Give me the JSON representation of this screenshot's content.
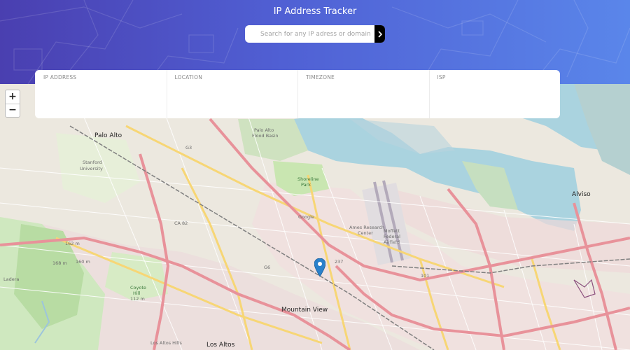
{
  "header": {
    "title": "IP Address Tracker",
    "search": {
      "placeholder": "Search for any IP adress or domain",
      "value": ""
    },
    "submit_icon": "chevron-right-icon"
  },
  "info_panel": {
    "ip_address": {
      "label": "IP ADDRESS",
      "value": ""
    },
    "location": {
      "label": "LOCATION",
      "value": ""
    },
    "timezone": {
      "label": "TIMEZONE",
      "value": ""
    },
    "isp": {
      "label": "ISP",
      "value": ""
    }
  },
  "map": {
    "zoom_in": "+",
    "zoom_out": "−",
    "marker_icon": "map-pin-icon",
    "labels": {
      "palo_alto": "Palo Alto",
      "stanford": "Stanford",
      "university": "University",
      "mountain_view": "Mountain View",
      "los_altos": "Los Altos",
      "los_altos_hills": "Los Altos Hills",
      "alviso": "Alviso",
      "ladera": "Ladera",
      "shoreline": "Shoreline",
      "park": "Park",
      "google": "Google",
      "ames": "Ames Research",
      "center": "Center",
      "moffett": "Moffett",
      "federal": "Federal",
      "airfield": "Airfield",
      "palo_alto_flood": "Palo Alto",
      "flood_basin": "Flood Basin",
      "coyote_hill": "Coyote",
      "hill": "Hill",
      "h162": "162 m",
      "h168": "168 m",
      "h160": "160 m",
      "h112": "112 m",
      "g3": "G3",
      "g6": "G6",
      "ca82": "CA 82",
      "r101": "101",
      "r237": "237"
    }
  }
}
